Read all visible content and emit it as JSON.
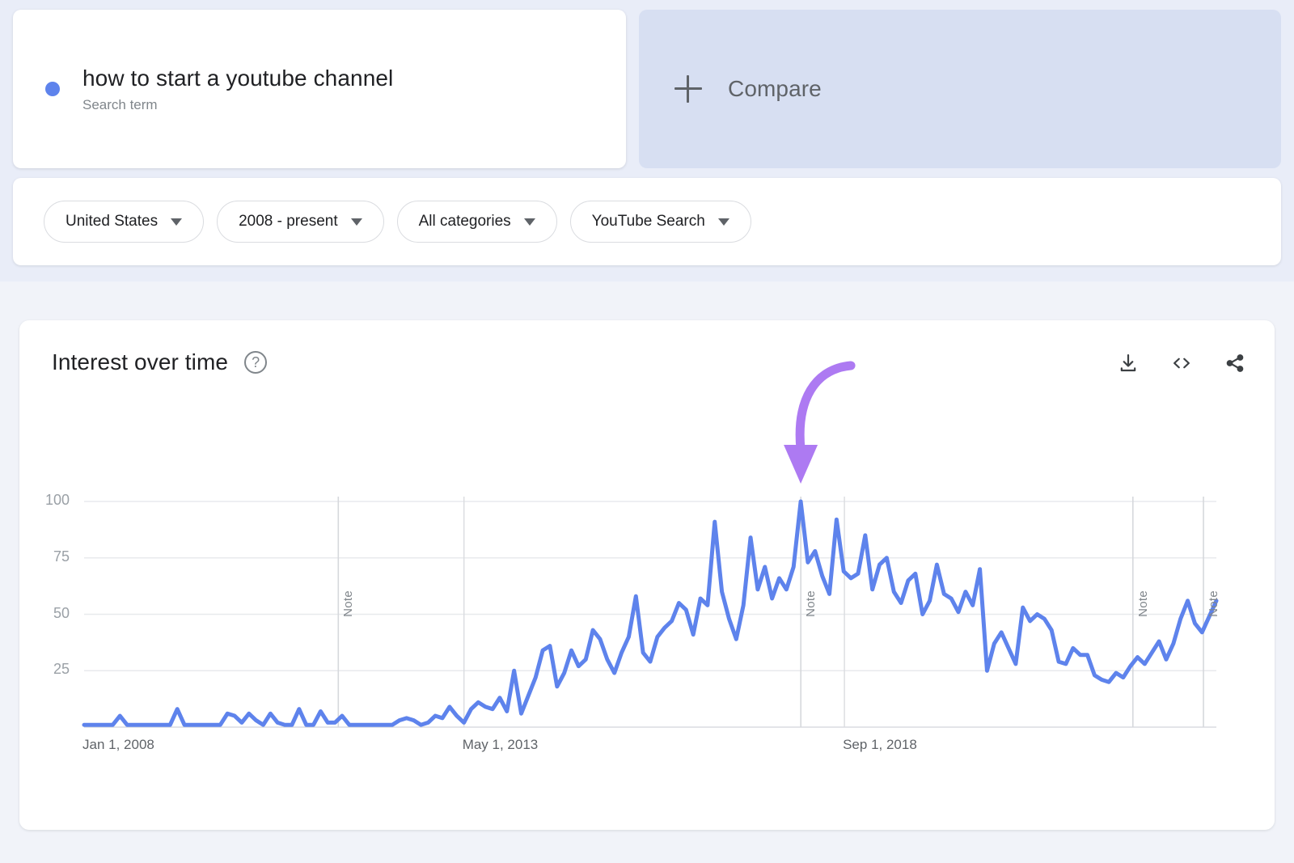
{
  "search_card": {
    "term": "how to start a youtube channel",
    "subtitle": "Search term",
    "dot_color": "#5e83ec"
  },
  "compare_card": {
    "label": "Compare",
    "plus_icon": "plus-icon",
    "bg_color": "#d7dff2"
  },
  "filters": [
    {
      "label": "United States"
    },
    {
      "label": "2008 - present"
    },
    {
      "label": "All categories"
    },
    {
      "label": "YouTube Search"
    }
  ],
  "chart_card": {
    "title": "Interest over time",
    "help_icon": "?",
    "actions": [
      {
        "name": "download-icon"
      },
      {
        "name": "embed-icon"
      },
      {
        "name": "share-icon"
      }
    ]
  },
  "chart_data": {
    "type": "line",
    "title": "Interest over time",
    "xlabel": "",
    "ylabel": "",
    "ylim": [
      0,
      100
    ],
    "grid": true,
    "legend": "none",
    "line_color": "#5e83ec",
    "series_name": "how to start a youtube channel",
    "y_ticks": [
      100,
      75,
      50,
      25
    ],
    "x_tick_labels": [
      "Jan 1, 2008",
      "May 1, 2013",
      "Sep 1, 2018"
    ],
    "x_tick_positions": [
      0,
      0.3355,
      0.6715
    ],
    "annotations": [
      {
        "label": "Note",
        "x": 0.2245
      },
      {
        "label": "Note",
        "x": 0.633
      },
      {
        "label": "Note",
        "x": 0.9263
      },
      {
        "label": "Note",
        "x": 0.9886
      }
    ],
    "arrow": {
      "name": "purple-annotation-arrow",
      "color": "#ad7af2",
      "points_to": "peak value 100"
    },
    "values": [
      1,
      1,
      1,
      1,
      1,
      5,
      1,
      1,
      1,
      1,
      1,
      1,
      1,
      8,
      1,
      1,
      1,
      1,
      1,
      1,
      6,
      5,
      2,
      6,
      3,
      1,
      6,
      2,
      1,
      1,
      8,
      1,
      1,
      7,
      2,
      2,
      5,
      1,
      1,
      1,
      1,
      1,
      1,
      1,
      3,
      4,
      3,
      1,
      2,
      5,
      4,
      9,
      5,
      2,
      8,
      11,
      9,
      8,
      13,
      7,
      25,
      6,
      14,
      22,
      34,
      36,
      18,
      24,
      34,
      27,
      30,
      43,
      39,
      30,
      24,
      33,
      40,
      58,
      33,
      29,
      40,
      44,
      47,
      55,
      52,
      41,
      57,
      54,
      91,
      60,
      48,
      39,
      54,
      84,
      61,
      71,
      57,
      66,
      61,
      71,
      100,
      73,
      78,
      67,
      59,
      92,
      69,
      66,
      68,
      85,
      61,
      72,
      75,
      60,
      55,
      65,
      68,
      50,
      56,
      72,
      59,
      57,
      51,
      60,
      54,
      70,
      25,
      37,
      42,
      35,
      28,
      53,
      47,
      50,
      48,
      43,
      29,
      28,
      35,
      32,
      32,
      23,
      21,
      20,
      24,
      22,
      27,
      31,
      28,
      33,
      38,
      30,
      37,
      48,
      56,
      46,
      42,
      49,
      56
    ]
  }
}
